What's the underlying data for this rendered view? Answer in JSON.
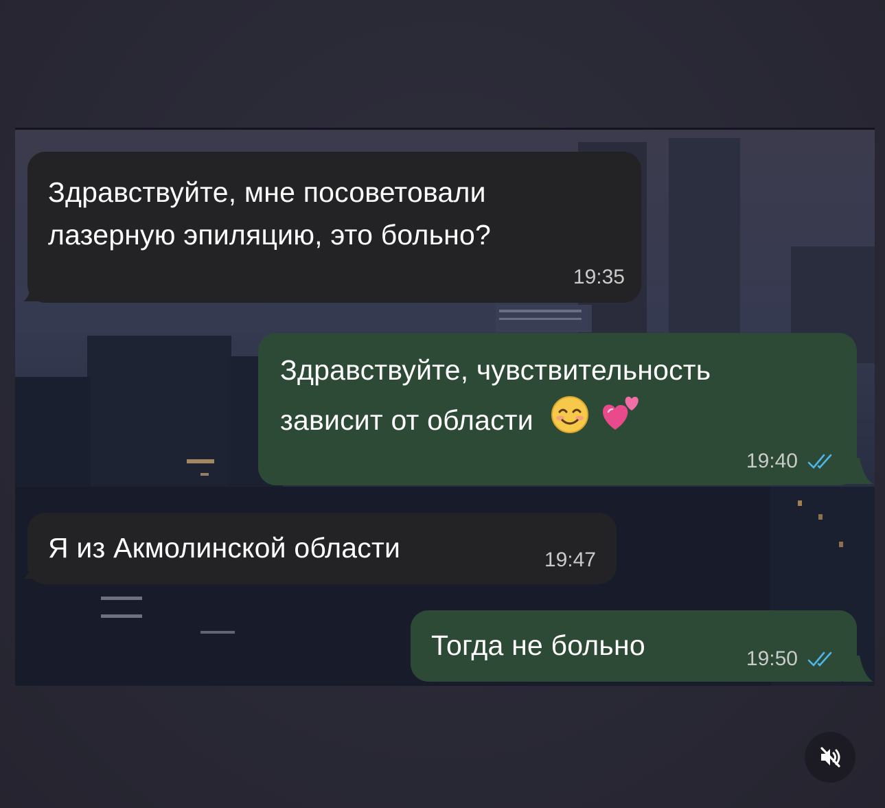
{
  "messages": [
    {
      "id": "m1",
      "direction": "incoming",
      "lines": [
        "Здравствуйте, мне посоветовали",
        "лазерную эпиляцию, это больно?"
      ],
      "time": "19:35"
    },
    {
      "id": "m2",
      "direction": "outgoing",
      "lines": [
        "Здравствуйте, чувствительность",
        "зависит от области"
      ],
      "emojis": [
        "smiling-face-icon",
        "two-hearts-icon"
      ],
      "time": "19:40",
      "read": true
    },
    {
      "id": "m3",
      "direction": "incoming",
      "lines": [
        "Я из Акмолинской области"
      ],
      "time": "19:47"
    },
    {
      "id": "m4",
      "direction": "outgoing",
      "lines": [
        "Тогда не больно"
      ],
      "time": "19:50",
      "read": true
    }
  ],
  "controls": {
    "mute_icon": "speaker-muted-icon"
  },
  "colors": {
    "incoming_bubble": "#232326",
    "outgoing_bubble": "#2d4a36",
    "read_checks": "#4fb6ec",
    "page_background": "#2b2a36"
  }
}
